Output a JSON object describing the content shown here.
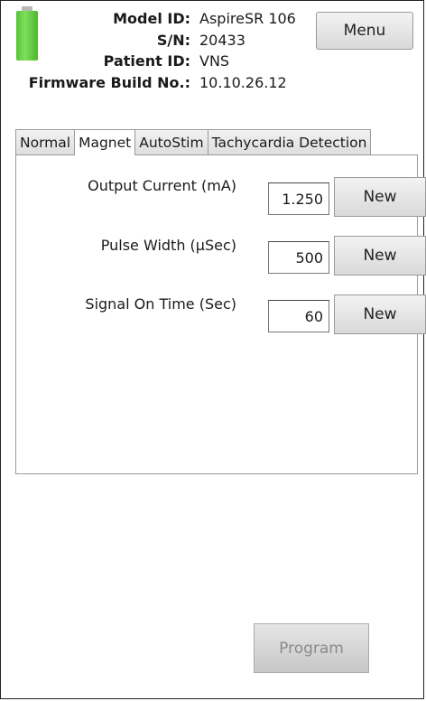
{
  "device": {
    "labels": {
      "model": "Model ID:",
      "serial": "S/N:",
      "patient": "Patient ID:",
      "firmware": "Firmware Build No.:"
    },
    "values": {
      "model": "AspireSR 106",
      "serial": "20433",
      "patient": "VNS",
      "firmware": "10.10.26.12"
    },
    "battery_icon": "battery-full-icon",
    "battery_color": "#5cc83a"
  },
  "menu": {
    "label": "Menu"
  },
  "tabs": [
    {
      "label": "Normal",
      "active": false
    },
    {
      "label": "Magnet",
      "active": true
    },
    {
      "label": "AutoStim",
      "active": false
    },
    {
      "label": "Tachycardia Detection",
      "active": false
    }
  ],
  "parameters": [
    {
      "label": "Output Current (mA)",
      "value": "1.250",
      "button": "New"
    },
    {
      "label": "Pulse Width (µSec)",
      "value": "500",
      "button": "New"
    },
    {
      "label": "Signal On Time (Sec)",
      "value": "60",
      "button": "New"
    }
  ],
  "program": {
    "label": "Program",
    "enabled": false
  }
}
